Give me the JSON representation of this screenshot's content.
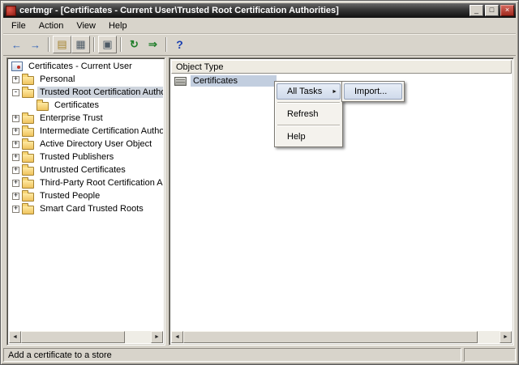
{
  "window": {
    "title": "certmgr - [Certificates - Current User\\Trusted Root Certification Authorities]",
    "buttons": {
      "minimize_glyph": "_",
      "maximize_glyph": "□",
      "close_glyph": "×"
    }
  },
  "menu_bar": {
    "items": [
      "File",
      "Action",
      "View",
      "Help"
    ]
  },
  "toolbar": {
    "buttons": [
      {
        "name": "back",
        "glyph": "←"
      },
      {
        "name": "forward",
        "glyph": "→"
      },
      {
        "name": "show-hide-console-tree",
        "glyph": "▤"
      },
      {
        "name": "properties",
        "glyph": "▦"
      },
      {
        "name": "copy",
        "glyph": "▣"
      },
      {
        "name": "refresh",
        "glyph": "↻"
      },
      {
        "name": "export-list",
        "glyph": "⇒"
      },
      {
        "name": "help",
        "glyph": "?"
      }
    ]
  },
  "tree": {
    "root": {
      "label": "Certificates - Current User"
    },
    "items": [
      {
        "label": "Personal",
        "expand": "+"
      },
      {
        "label": "Trusted Root Certification Authorities",
        "expand": "-",
        "selected": true
      },
      {
        "label": "Certificates",
        "expand": ""
      },
      {
        "label": "Enterprise Trust",
        "expand": "+"
      },
      {
        "label": "Intermediate Certification Authorities",
        "expand": "+"
      },
      {
        "label": "Active Directory User Object",
        "expand": "+"
      },
      {
        "label": "Trusted Publishers",
        "expand": "+"
      },
      {
        "label": "Untrusted Certificates",
        "expand": "+"
      },
      {
        "label": "Third-Party Root Certification Authorities",
        "expand": "+"
      },
      {
        "label": "Trusted People",
        "expand": "+"
      },
      {
        "label": "Smart Card Trusted Roots",
        "expand": "+"
      }
    ]
  },
  "list": {
    "column_header": "Object Type",
    "items": [
      {
        "label": "Certificates",
        "selected": true
      }
    ]
  },
  "context_menu": {
    "items": [
      {
        "label": "All Tasks",
        "has_submenu": true,
        "highlighted": true
      },
      {
        "label": "Refresh"
      },
      {
        "label": "Help"
      }
    ],
    "submenu_arrow_glyph": "►"
  },
  "submenu": {
    "items": [
      {
        "label": "Import...",
        "highlighted": true
      }
    ]
  },
  "status_bar": {
    "text": "Add a certificate to a store"
  },
  "scrollbar": {
    "left_glyph": "◄",
    "right_glyph": "►"
  },
  "colors": {
    "chrome": "#d8d4cb",
    "titlebar": "#1c1c1c",
    "tree_selection": "#cfd5de",
    "list_selection": "#c2cedf",
    "menu_highlight": "#cfdaeb",
    "close_button_red": "#a02a1e",
    "folder_yellow": "#efc45e"
  }
}
